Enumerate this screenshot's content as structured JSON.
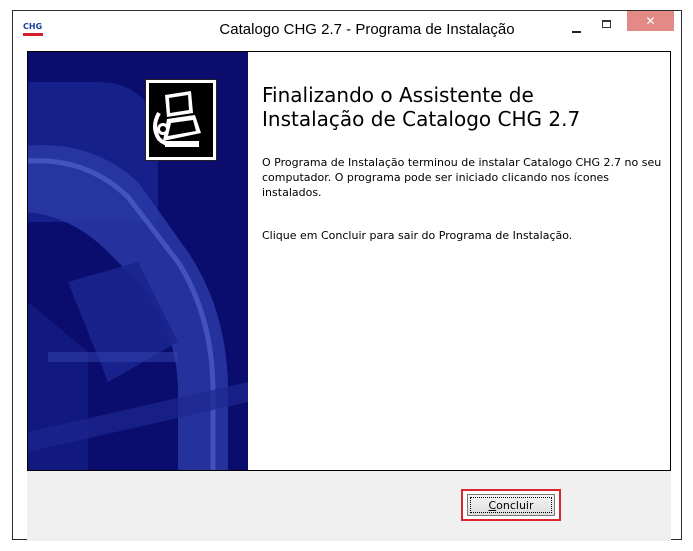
{
  "window": {
    "title": "Catalogo CHG 2.7 - Programa de Instalação",
    "app_icon_text": "CHG",
    "close_symbol": "✕"
  },
  "wizard": {
    "heading_line1": "Finalizando o Assistente de",
    "heading_line2": "Instalação de Catalogo CHG 2.7",
    "paragraph1": "O Programa de Instalação terminou de instalar Catalogo CHG 2.7 no seu computador. O programa pode ser iniciado clicando nos ícones instalados.",
    "paragraph2": "Clique em Concluir para sair do Programa de Instalação."
  },
  "buttons": {
    "finish_first": "C",
    "finish_rest": "oncluir"
  },
  "colors": {
    "banner": "#0b0d6e",
    "highlight": "#d9262e",
    "close_button": "#e48a86"
  },
  "icons": {
    "app": "chg-logo-icon",
    "installer": "installer-computer-icon",
    "minimize": "minimize-icon",
    "maximize": "maximize-icon",
    "close": "close-icon"
  }
}
